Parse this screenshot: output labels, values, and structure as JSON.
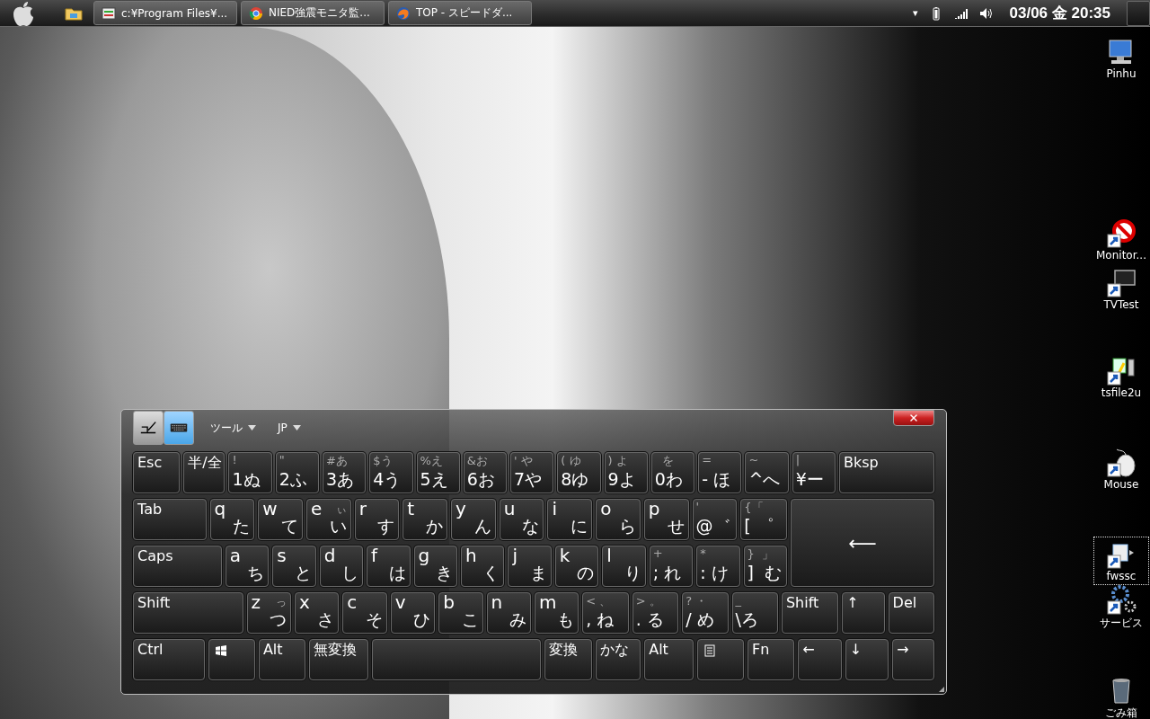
{
  "taskbar": {
    "tasks": [
      {
        "label": "c:¥Program Files¥..."
      },
      {
        "label": "NIED強震モニタ監..."
      },
      {
        "label": "TOP - スピードダ..."
      }
    ],
    "tray_arrow": "▾",
    "clock": "03/06 金 20:35"
  },
  "desktop_icons": [
    {
      "kind": "computer",
      "label": "Pinhu",
      "selected": false
    },
    {
      "kind": "monitor",
      "label": "Monitor...",
      "selected": false
    },
    {
      "kind": "tv",
      "label": "TVTest",
      "selected": false
    },
    {
      "kind": "file",
      "label": "tsfile2u",
      "selected": false
    },
    {
      "kind": "mouse",
      "label": "Mouse",
      "selected": false
    },
    {
      "kind": "folder",
      "label": "fwssc",
      "selected": true
    },
    {
      "kind": "gears",
      "label": "サービス",
      "selected": false
    },
    {
      "kind": "trash",
      "label": "ごみ箱",
      "selected": false
    }
  ],
  "keyboard": {
    "modes": [
      {
        "kind": "pen",
        "selected": false
      },
      {
        "kind": "keyboard",
        "selected": true
      }
    ],
    "menus": [
      {
        "label": "ツール"
      },
      {
        "label": "JP"
      }
    ],
    "rows": [
      {
        "keys": [
          {
            "kind": "label",
            "label": "Esc"
          },
          {
            "kind": "label",
            "label": "半/全"
          },
          {
            "kind": "symbol",
            "upper": "!",
            "lower": "1ぬ"
          },
          {
            "kind": "symbol",
            "upper": "\"",
            "lower": "2ふ"
          },
          {
            "kind": "symbol",
            "upper": "#あ",
            "lower": "3あ"
          },
          {
            "kind": "symbol",
            "upper": "$う",
            "lower": "4う"
          },
          {
            "kind": "symbol",
            "upper": "%え",
            "lower": "5え"
          },
          {
            "kind": "symbol",
            "upper": "&お",
            "lower": "6お"
          },
          {
            "kind": "symbol",
            "upper": "' や",
            "lower": "7や"
          },
          {
            "kind": "symbol",
            "upper": "( ゆ",
            "lower": "8ゆ"
          },
          {
            "kind": "symbol",
            "upper": ") よ",
            "lower": "9よ"
          },
          {
            "kind": "symbol",
            "upper": "  を",
            "lower": "0わ"
          },
          {
            "kind": "symbol",
            "upper": "=",
            "lower": "- ほ"
          },
          {
            "kind": "symbol",
            "upper": "~",
            "lower": "^へ"
          },
          {
            "kind": "symbol",
            "upper": "|",
            "lower": "¥ー"
          },
          {
            "kind": "label",
            "label": "Bksp"
          }
        ]
      },
      {
        "keys": [
          {
            "kind": "label",
            "label": "Tab"
          },
          {
            "kind": "letter",
            "letter": "q",
            "kana": "た"
          },
          {
            "kind": "letter",
            "letter": "w",
            "kana": "て"
          },
          {
            "kind": "letter",
            "letter": "e",
            "small": "ぃ",
            "kana": "い"
          },
          {
            "kind": "letter",
            "letter": "r",
            "kana": "す"
          },
          {
            "kind": "letter",
            "letter": "t",
            "kana": "か"
          },
          {
            "kind": "letter",
            "letter": "y",
            "kana": "ん"
          },
          {
            "kind": "letter",
            "letter": "u",
            "kana": "な"
          },
          {
            "kind": "letter",
            "letter": "i",
            "kana": "に"
          },
          {
            "kind": "letter",
            "letter": "o",
            "kana": "ら"
          },
          {
            "kind": "letter",
            "letter": "p",
            "kana": "せ"
          },
          {
            "kind": "symbol",
            "upper": "'",
            "lower": "@゛"
          },
          {
            "kind": "symbol",
            "upper": "{「",
            "lower": "[ ゜"
          }
        ]
      },
      {
        "keys": [
          {
            "kind": "label",
            "label": "Caps"
          },
          {
            "kind": "letter",
            "letter": "a",
            "kana": "ち"
          },
          {
            "kind": "letter",
            "letter": "s",
            "kana": "と"
          },
          {
            "kind": "letter",
            "letter": "d",
            "kana": "し"
          },
          {
            "kind": "letter",
            "letter": "f",
            "kana": "は"
          },
          {
            "kind": "letter",
            "letter": "g",
            "kana": "き"
          },
          {
            "kind": "letter",
            "letter": "h",
            "kana": "く"
          },
          {
            "kind": "letter",
            "letter": "j",
            "kana": "ま"
          },
          {
            "kind": "letter",
            "letter": "k",
            "kana": "の"
          },
          {
            "kind": "letter",
            "letter": "l",
            "kana": "り"
          },
          {
            "kind": "symbol",
            "upper": "+",
            "lower": "; れ"
          },
          {
            "kind": "symbol",
            "upper": "*",
            "lower": ": け"
          },
          {
            "kind": "symbol",
            "upper": "}  」",
            "lower": "]  む"
          }
        ]
      },
      {
        "keys": [
          {
            "kind": "label",
            "label": "Shift"
          },
          {
            "kind": "letter",
            "letter": "z",
            "small": "っ",
            "kana": "つ"
          },
          {
            "kind": "letter",
            "letter": "x",
            "kana": "さ"
          },
          {
            "kind": "letter",
            "letter": "c",
            "kana": "そ"
          },
          {
            "kind": "letter",
            "letter": "v",
            "kana": "ひ"
          },
          {
            "kind": "letter",
            "letter": "b",
            "kana": "こ"
          },
          {
            "kind": "letter",
            "letter": "n",
            "kana": "み"
          },
          {
            "kind": "letter",
            "letter": "m",
            "kana": "も"
          },
          {
            "kind": "symbol",
            "upper": "< 、",
            "lower": ", ね"
          },
          {
            "kind": "symbol",
            "upper": "> 。",
            "lower": ". る"
          },
          {
            "kind": "symbol",
            "upper": "? ・",
            "lower": "/ め"
          },
          {
            "kind": "symbol",
            "upper": "_",
            "lower": "\\ろ"
          },
          {
            "kind": "label",
            "label": "Shift"
          },
          {
            "kind": "label",
            "label": "↑"
          },
          {
            "kind": "label",
            "label": "Del"
          }
        ]
      },
      {
        "keys": [
          {
            "kind": "label",
            "label": "Ctrl"
          },
          {
            "kind": "logo"
          },
          {
            "kind": "label",
            "label": "Alt"
          },
          {
            "kind": "label",
            "label": "無変換"
          },
          {
            "kind": "space"
          },
          {
            "kind": "label",
            "label": "変換"
          },
          {
            "kind": "label",
            "label": "かな"
          },
          {
            "kind": "label",
            "label": "Alt"
          },
          {
            "kind": "menu"
          },
          {
            "kind": "label",
            "label": "Fn"
          },
          {
            "kind": "label",
            "label": "←"
          },
          {
            "kind": "label",
            "label": "↓"
          },
          {
            "kind": "label",
            "label": "→"
          }
        ]
      }
    ],
    "enter_key": {
      "label": "⟵"
    }
  }
}
